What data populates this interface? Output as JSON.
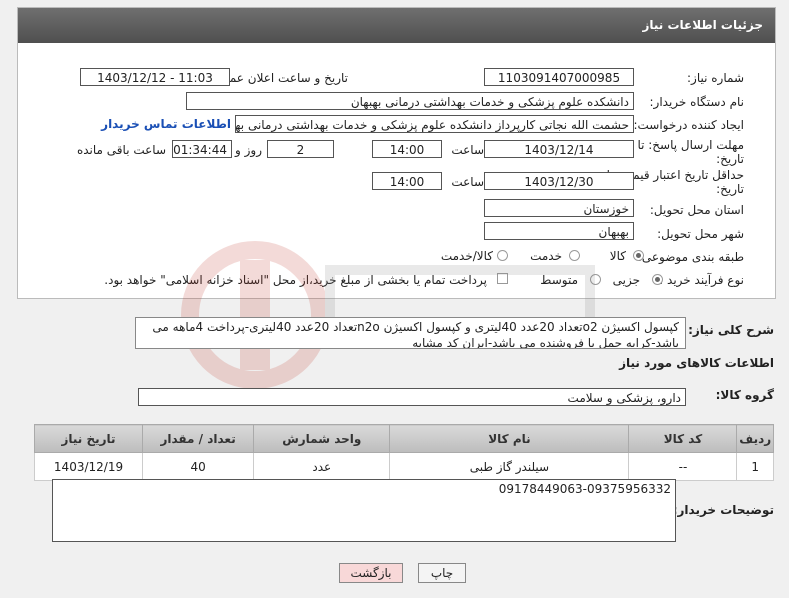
{
  "header": {
    "title": "جزئیات اطلاعات نیاز"
  },
  "fields": {
    "need_number_label": "شماره نیاز:",
    "need_number": "1103091407000985",
    "announce_label": "تاریخ و ساعت اعلان عمومی:",
    "announce_value": "1403/12/12 - 11:03",
    "buyer_org_label": "نام دستگاه خریدار:",
    "buyer_org": "دانشکده علوم پزشکی و خدمات بهداشتی  درمانی بهبهان",
    "creator_label": "ایجاد کننده درخواست:",
    "creator": "حشمت الله نجاتی کارپرداز دانشکده علوم پزشکی و خدمات بهداشتی  درمانی بهبهان",
    "contact_link": "اطلاعات تماس خریدار",
    "reply_deadline_label": "مهلت ارسال پاسخ: تا",
    "reply_deadline_label2": "تاریخ:",
    "reply_date": "1403/12/14",
    "time_label": "ساعت",
    "reply_time": "14:00",
    "days_value": "2",
    "days_label": "روز و",
    "remaining_time": "01:34:44",
    "remaining_label": "ساعت باقی مانده",
    "price_validity_label": "حداقل تاریخ اعتبار قیمت: تا",
    "price_validity_label2": "تاریخ:",
    "price_date": "1403/12/30",
    "price_time": "14:00",
    "province_label": "استان محل تحویل:",
    "province": "خوزستان",
    "city_label": "شهر محل تحویل:",
    "city": "بهبهان",
    "category_label": "طبقه بندی موضوعی:",
    "category_options": [
      "کالا",
      "خدمت",
      "کالا/خدمت"
    ],
    "process_label": "نوع فرآیند خرید :",
    "process_options": [
      "جزیی",
      "متوسط"
    ],
    "payment_note": "پرداخت تمام یا بخشی از مبلغ خرید،از محل \"اسناد خزانه اسلامی\" خواهد بود."
  },
  "description": {
    "label": "شرح کلی نیاز:",
    "text": "کپسول اکسیژن o2تعداد 20عدد 40لیتری و کپسول اکسیژن n2oتعداد 20عدد 40لیتری-پرداخت 4ماهه می باشد-کرایه حمل با فروشنده می باشد-ایران کد مشابه"
  },
  "goods": {
    "section_title": "اطلاعات کالاهای مورد نیاز",
    "group_label": "گروه کالا:",
    "group_value": "دارو، پزشکی و سلامت",
    "columns": [
      "ردیف",
      "کد کالا",
      "نام کالا",
      "واحد شمارش",
      "تعداد / مقدار",
      "تاریخ نیاز"
    ],
    "rows": [
      [
        "1",
        "--",
        "سیلندر گاز طبی",
        "عدد",
        "40",
        "1403/12/19"
      ]
    ]
  },
  "buyer_notes": {
    "label": "توضیحات خریدار:",
    "text": "09178449063-09375956332"
  },
  "buttons": {
    "print": "چاپ",
    "back": "بازگشت"
  },
  "colors": {
    "header_bg": "#5c5c5c",
    "link": "#1a4fb5",
    "back_btn": "#f8d8d8"
  }
}
